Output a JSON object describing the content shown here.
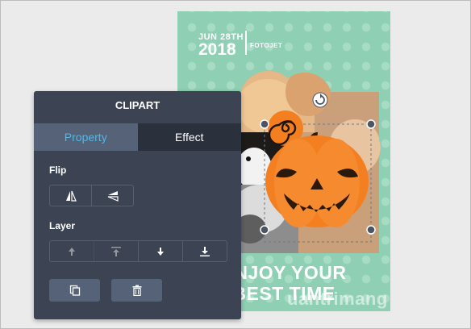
{
  "design": {
    "date_line": "JUN 28TH",
    "year": "2018",
    "brand": "FOTOJET",
    "headline_line1": "ENJOY YOUR",
    "headline_line2": "BEST TIME",
    "background_color": "#8fcfb3",
    "pumpkin_color": "#f47f20"
  },
  "panel": {
    "title": "CLIPART",
    "tabs": [
      {
        "label": "Property",
        "active": true
      },
      {
        "label": "Effect",
        "active": false
      }
    ],
    "flip": {
      "label": "Flip",
      "buttons": [
        {
          "name": "flip-horizontal",
          "icon": "flip-horizontal-icon"
        },
        {
          "name": "flip-vertical",
          "icon": "flip-vertical-icon"
        }
      ]
    },
    "layer": {
      "label": "Layer",
      "buttons": [
        {
          "name": "bring-forward",
          "icon": "arrow-up-icon",
          "enabled": false
        },
        {
          "name": "bring-to-front",
          "icon": "arrow-up-top-icon",
          "enabled": false
        },
        {
          "name": "send-backward",
          "icon": "arrow-down-icon",
          "enabled": true
        },
        {
          "name": "send-to-back",
          "icon": "arrow-down-bottom-icon",
          "enabled": true
        }
      ]
    },
    "actions": [
      {
        "name": "duplicate",
        "icon": "copy-icon"
      },
      {
        "name": "delete",
        "icon": "trash-icon"
      }
    ],
    "accent_color": "#52b8e6"
  },
  "watermark": {
    "text": "uantrimang"
  }
}
